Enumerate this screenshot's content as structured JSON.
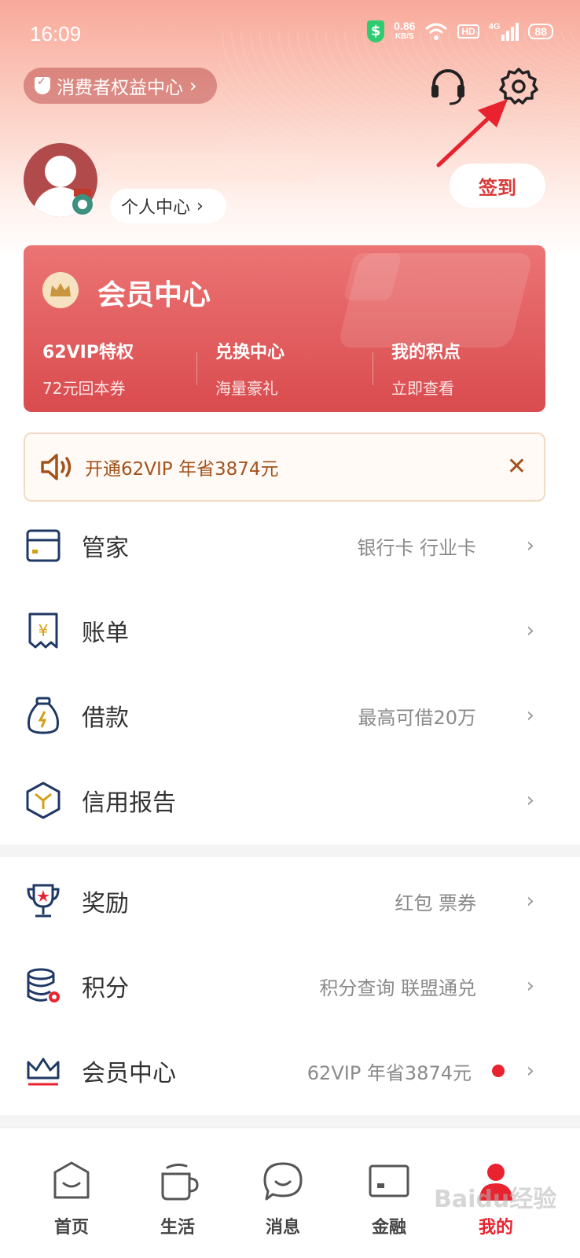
{
  "status_bar": {
    "time": "16:09",
    "speed": "0.86",
    "speed_unit": "KB/S",
    "hd": "HD",
    "network": "4G",
    "battery": "88"
  },
  "header": {
    "rights_label": "消费者权益中心",
    "personal_center": "个人中心",
    "checkin": "签到"
  },
  "vip_card": {
    "title": "会员中心",
    "columns": [
      {
        "title": "62VIP特权",
        "sub": "72元回本券"
      },
      {
        "title": "兑换中心",
        "sub": "海量豪礼"
      },
      {
        "title": "我的积点",
        "sub": "立即查看"
      }
    ]
  },
  "promo": {
    "text": "开通62VIP 年省3874元"
  },
  "menu": [
    {
      "label": "管家",
      "sub": "银行卡 行业卡",
      "icon": "card-icon"
    },
    {
      "label": "账单",
      "sub": "",
      "icon": "bill-icon"
    },
    {
      "label": "借款",
      "sub": "最高可借20万",
      "icon": "money-bag-icon"
    },
    {
      "label": "信用报告",
      "sub": "",
      "icon": "credit-report-icon"
    },
    {
      "label": "奖励",
      "sub": "红包 票券",
      "icon": "trophy-icon"
    },
    {
      "label": "积分",
      "sub": "积分查询 联盟通兑",
      "icon": "coins-icon"
    },
    {
      "label": "会员中心",
      "sub": "62VIP 年省3874元",
      "icon": "crown-icon"
    }
  ],
  "tabs": [
    {
      "label": "首页",
      "icon": "home-icon"
    },
    {
      "label": "生活",
      "icon": "cup-icon"
    },
    {
      "label": "消息",
      "icon": "message-icon"
    },
    {
      "label": "金融",
      "icon": "card-icon"
    },
    {
      "label": "我的",
      "icon": "profile-icon"
    }
  ],
  "watermark": "Baidu经验",
  "colors": {
    "accent": "#e8232f",
    "vip_card": "#d94b4e",
    "promo_text": "#a4521c",
    "icon_navy": "#1f3864"
  }
}
